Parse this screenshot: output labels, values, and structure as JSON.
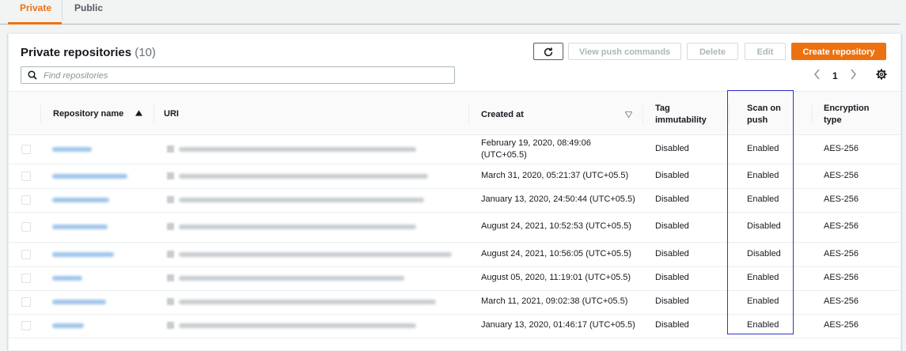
{
  "tabs": [
    {
      "label": "Private",
      "active": true
    },
    {
      "label": "Public",
      "active": false
    }
  ],
  "panel": {
    "title": "Private repositories",
    "count": "(10)"
  },
  "toolbar": {
    "view_push_commands": "View push commands",
    "delete": "Delete",
    "edit": "Edit",
    "create_repository": "Create repository"
  },
  "search": {
    "placeholder": "Find repositories",
    "value": ""
  },
  "pagination": {
    "current_page": "1"
  },
  "columns": {
    "repository_name": "Repository name",
    "uri": "URI",
    "created_at": "Created at",
    "tag_immutability_1": "Tag",
    "tag_immutability_2": "immutability",
    "scan_on_push_1": "Scan on",
    "scan_on_push_2": "push",
    "encryption_1": "Encryption",
    "encryption_2": "type"
  },
  "rows": [
    {
      "created_line1": "February 19, 2020, 08:49:06",
      "created_line2": "(UTC+05.5)",
      "tag": "Disabled",
      "scan": "Enabled",
      "enc": "AES-256"
    },
    {
      "created_line1": "March 31, 2020, 05:21:37 (UTC+05.5)",
      "created_line2": "",
      "tag": "Disabled",
      "scan": "Enabled",
      "enc": "AES-256"
    },
    {
      "created_line1": "January 13, 2020, 24:50:44 (UTC+05.5)",
      "created_line2": "",
      "tag": "Disabled",
      "scan": "Enabled",
      "enc": "AES-256"
    },
    {
      "created_line1": "August 24, 2021, 10:52:53 (UTC+05.5)",
      "created_line2": "",
      "tag": "Disabled",
      "scan": "Disabled",
      "enc": "AES-256"
    },
    {
      "created_line1": "August 24, 2021, 10:56:05 (UTC+05.5)",
      "created_line2": "",
      "tag": "Disabled",
      "scan": "Disabled",
      "enc": "AES-256"
    },
    {
      "created_line1": "August 05, 2020, 11:19:01 (UTC+05.5)",
      "created_line2": "",
      "tag": "Disabled",
      "scan": "Enabled",
      "enc": "AES-256"
    },
    {
      "created_line1": "March 11, 2021, 09:02:38 (UTC+05.5)",
      "created_line2": "",
      "tag": "Disabled",
      "scan": "Enabled",
      "enc": "AES-256"
    },
    {
      "created_line1": "January 13, 2020, 01:46:17 (UTC+05.5)",
      "created_line2": "",
      "tag": "Disabled",
      "scan": "Enabled",
      "enc": "AES-256"
    }
  ],
  "icons": {
    "refresh": "refresh-icon",
    "search": "search-icon",
    "sort_asc": "sort-ascending-icon",
    "sort_desc": "sort-descending-icon",
    "prev": "chevron-left-icon",
    "next": "chevron-right-icon",
    "settings": "gear-icon"
  },
  "colors": {
    "accent": "#ec7211",
    "highlight": "#3333cc"
  }
}
